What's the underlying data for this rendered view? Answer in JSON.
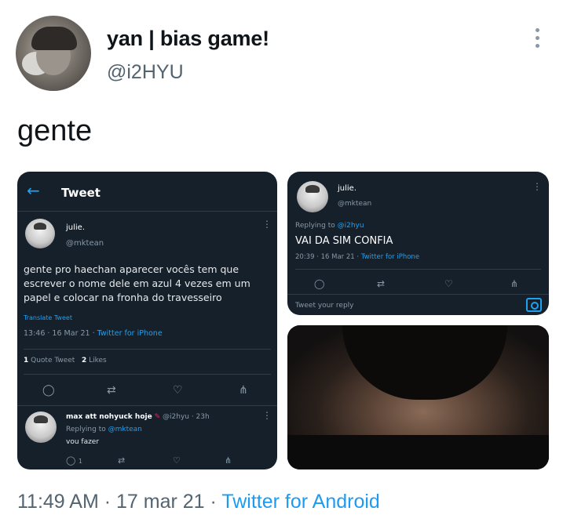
{
  "author": {
    "display_name": "yan | bias game!",
    "handle": "@i2HYU"
  },
  "tweet": {
    "text": "gente",
    "time": "11:49 AM",
    "date": "17 mar 21",
    "source": "Twitter for Android",
    "separator": "·"
  },
  "embedded_1": {
    "header_title": "Tweet",
    "name": "julie.",
    "handle": "@mktean",
    "text_line1": "gente pro haechan aparecer vocês tem que",
    "text_line2": "escrever o nome dele em azul 4 vezes em um",
    "text_line3": "papel e colocar na fronha do travesseiro",
    "translate": "Translate Tweet",
    "time": "13:46 · 16 Mar 21 ·",
    "source": "Twitter for iPhone",
    "quote_count": "1",
    "quote_label": "Quote Tweet",
    "likes_count": "2",
    "likes_label": "Likes",
    "reply": {
      "name": "max att nohyuck hoje",
      "handle": "@i2hyu · 23h",
      "replying_label": "Replying to",
      "replying_to": "@mktean",
      "text": "vou fazer",
      "reply_count": "1"
    }
  },
  "embedded_2": {
    "name": "julie.",
    "handle": "@mktean",
    "replying_label": "Replying to",
    "replying_to": "@i2hyu",
    "text": "VAI DA SIM CONFIA",
    "time": "20:39 · 16 Mar 21 ·",
    "source": "Twitter for iPhone",
    "reply_placeholder": "Tweet your reply"
  },
  "colors": {
    "link_blue": "#1d9bf0",
    "dark_bg": "#15202b",
    "muted": "#536471"
  }
}
